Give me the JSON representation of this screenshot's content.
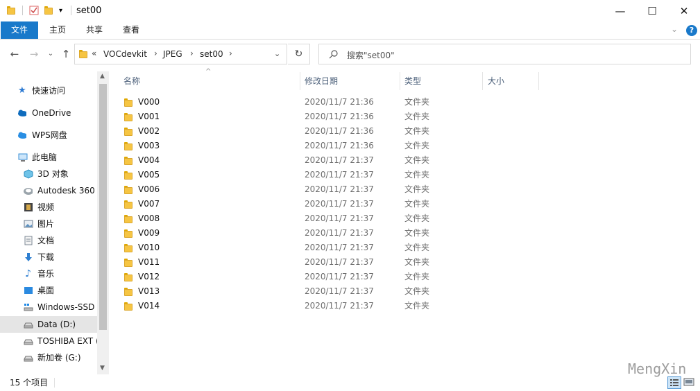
{
  "window": {
    "title": "set00"
  },
  "ribbon": {
    "tabs": [
      "文件",
      "主页",
      "共享",
      "查看"
    ]
  },
  "address": {
    "overflow": "«",
    "crumbs": [
      "VOCdevkit",
      "JPEG",
      "set00"
    ],
    "refresh_glyph": "↻"
  },
  "search": {
    "placeholder": "搜索\"set00\""
  },
  "nav": {
    "items": [
      {
        "label": "快速访问",
        "icon": "star-icon"
      },
      {
        "label": "OneDrive",
        "icon": "cloud-icon"
      },
      {
        "label": "WPS网盘",
        "icon": "cloud-icon"
      },
      {
        "label": "此电脑",
        "icon": "computer-icon"
      },
      {
        "label": "3D 对象",
        "icon": "cube-icon"
      },
      {
        "label": "Autodesk 360",
        "icon": "autodesk-icon"
      },
      {
        "label": "视频",
        "icon": "video-icon"
      },
      {
        "label": "图片",
        "icon": "picture-icon"
      },
      {
        "label": "文档",
        "icon": "document-icon"
      },
      {
        "label": "下载",
        "icon": "download-icon"
      },
      {
        "label": "音乐",
        "icon": "music-icon"
      },
      {
        "label": "桌面",
        "icon": "desktop-icon"
      },
      {
        "label": "Windows-SSD",
        "icon": "drive-icon"
      },
      {
        "label": "Data (D:)",
        "icon": "drive-icon"
      },
      {
        "label": "TOSHIBA EXT (",
        "icon": "drive-icon"
      },
      {
        "label": "新加卷 (G:)",
        "icon": "drive-icon"
      }
    ]
  },
  "columns": {
    "name": "名称",
    "date": "修改日期",
    "type": "类型",
    "size": "大小"
  },
  "files": [
    {
      "name": "V000",
      "date": "2020/11/7 21:36",
      "type": "文件夹"
    },
    {
      "name": "V001",
      "date": "2020/11/7 21:36",
      "type": "文件夹"
    },
    {
      "name": "V002",
      "date": "2020/11/7 21:36",
      "type": "文件夹"
    },
    {
      "name": "V003",
      "date": "2020/11/7 21:36",
      "type": "文件夹"
    },
    {
      "name": "V004",
      "date": "2020/11/7 21:37",
      "type": "文件夹"
    },
    {
      "name": "V005",
      "date": "2020/11/7 21:37",
      "type": "文件夹"
    },
    {
      "name": "V006",
      "date": "2020/11/7 21:37",
      "type": "文件夹"
    },
    {
      "name": "V007",
      "date": "2020/11/7 21:37",
      "type": "文件夹"
    },
    {
      "name": "V008",
      "date": "2020/11/7 21:37",
      "type": "文件夹"
    },
    {
      "name": "V009",
      "date": "2020/11/7 21:37",
      "type": "文件夹"
    },
    {
      "name": "V010",
      "date": "2020/11/7 21:37",
      "type": "文件夹"
    },
    {
      "name": "V011",
      "date": "2020/11/7 21:37",
      "type": "文件夹"
    },
    {
      "name": "V012",
      "date": "2020/11/7 21:37",
      "type": "文件夹"
    },
    {
      "name": "V013",
      "date": "2020/11/7 21:37",
      "type": "文件夹"
    },
    {
      "name": "V014",
      "date": "2020/11/7 21:37",
      "type": "文件夹"
    }
  ],
  "status": {
    "count": "15 个项目"
  },
  "watermark": "MengXin",
  "colors": {
    "accent": "#1979ca",
    "folder": "#f6c543",
    "selected": "#e5e5e5"
  }
}
